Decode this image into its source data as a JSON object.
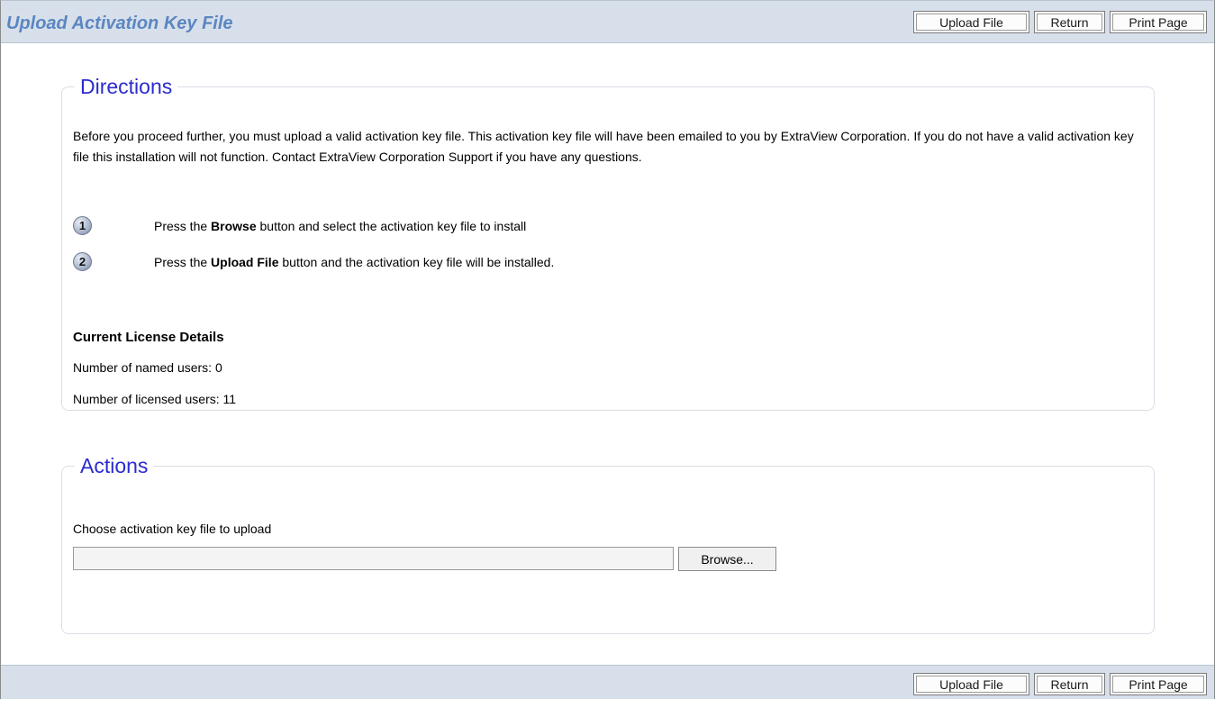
{
  "header": {
    "title": "Upload Activation Key File",
    "buttons": {
      "upload": "Upload File",
      "return": "Return",
      "print": "Print Page"
    }
  },
  "directions": {
    "legend": "Directions",
    "paragraph": "Before you proceed further, you must upload a valid activation key file. This activation key file will have been emailed to you by ExtraView Corporation. If you do not have a valid activation key file this installation will not function. Contact ExtraView Corporation Support if you have any questions.",
    "steps": [
      {
        "number": "1",
        "pre": "Press the ",
        "bold": "Browse",
        "post": " button and select the activation key file to install"
      },
      {
        "number": "2",
        "pre": "Press the ",
        "bold": "Upload File",
        "post": " button and the activation key file will be installed."
      }
    ],
    "license": {
      "heading": "Current License Details",
      "named_users": "Number of named users: 0",
      "licensed_users": "Number of licensed users: 11"
    }
  },
  "actions": {
    "legend": "Actions",
    "choose_label": "Choose activation key file to upload",
    "file_value": "",
    "browse_label": "Browse..."
  },
  "footer": {
    "buttons": {
      "upload": "Upload File",
      "return": "Return",
      "print": "Print Page"
    }
  },
  "colors": {
    "bar_bg": "#d7dfeb",
    "title": "#5b86c0",
    "legend": "#2b2bd0"
  }
}
